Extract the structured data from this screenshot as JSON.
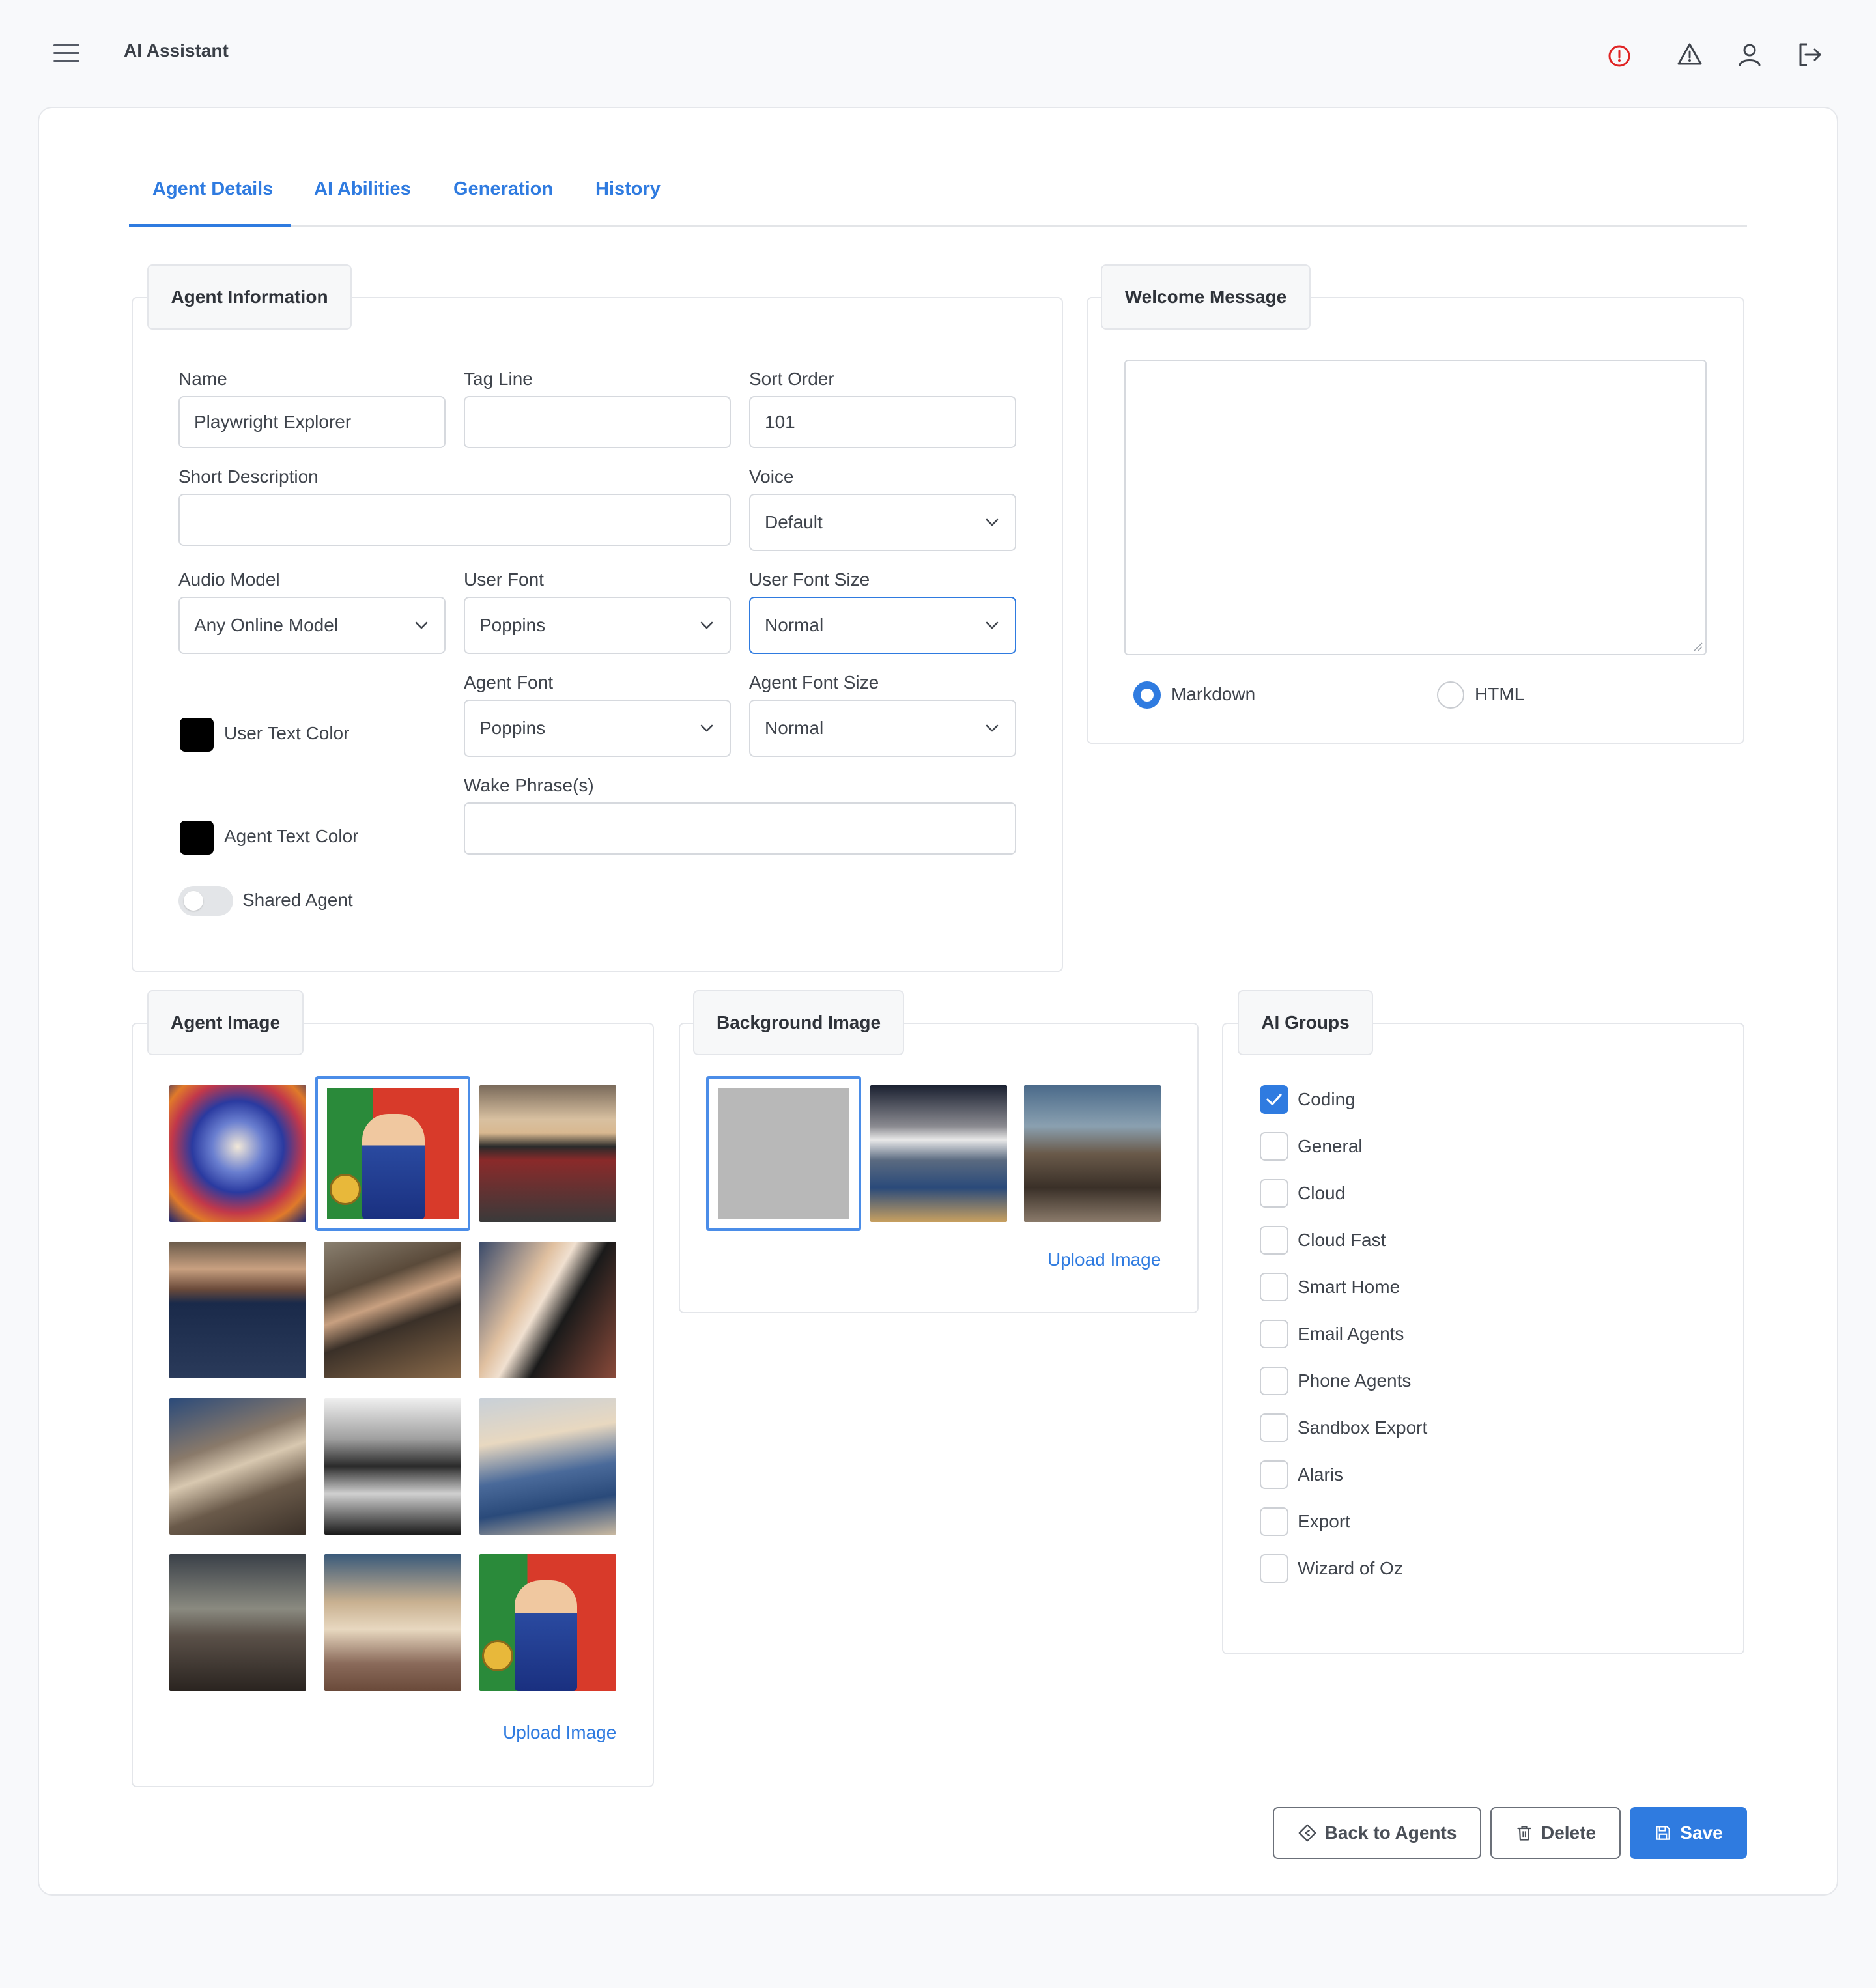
{
  "header": {
    "title": "AI Assistant",
    "icons": [
      "menu-icon",
      "alert-circle-icon",
      "warning-triangle-icon",
      "user-icon",
      "logout-icon"
    ],
    "alert_color": "#e02424"
  },
  "tabs": [
    {
      "label": "Agent Details",
      "active": true
    },
    {
      "label": "AI Abilities",
      "active": false
    },
    {
      "label": "Generation",
      "active": false
    },
    {
      "label": "History",
      "active": false
    }
  ],
  "agent_info": {
    "title": "Agent Information",
    "name_label": "Name",
    "name_value": "Playwright Explorer",
    "tagline_label": "Tag Line",
    "tagline_value": "",
    "sort_label": "Sort Order",
    "sort_value": "101",
    "short_desc_label": "Short Description",
    "short_desc_value": "",
    "voice_label": "Voice",
    "voice_value": "Default",
    "audio_model_label": "Audio Model",
    "audio_model_value": "Any Online Model",
    "user_font_label": "User Font",
    "user_font_value": "Poppins",
    "user_font_size_label": "User Font Size",
    "user_font_size_value": "Normal",
    "agent_font_label": "Agent Font",
    "agent_font_value": "Poppins",
    "agent_font_size_label": "Agent Font Size",
    "agent_font_size_value": "Normal",
    "user_text_color_label": "User Text Color",
    "user_text_color": "#000000",
    "agent_text_color_label": "Agent Text Color",
    "agent_text_color": "#000000",
    "wake_label": "Wake Phrase(s)",
    "wake_value": "",
    "shared_label": "Shared Agent",
    "shared_on": false
  },
  "welcome": {
    "title": "Welcome Message",
    "value": "",
    "format_markdown": "Markdown",
    "format_html": "HTML",
    "selected": "Markdown"
  },
  "agent_image": {
    "title": "Agent Image",
    "upload_label": "Upload Image",
    "selected_index": 1
  },
  "background_image": {
    "title": "Background Image",
    "upload_label": "Upload Image",
    "selected_index": 0
  },
  "ai_groups": {
    "title": "AI Groups",
    "items": [
      {
        "label": "Coding",
        "checked": true
      },
      {
        "label": "General",
        "checked": false
      },
      {
        "label": "Cloud",
        "checked": false
      },
      {
        "label": "Cloud Fast",
        "checked": false
      },
      {
        "label": "Smart Home",
        "checked": false
      },
      {
        "label": "Email Agents",
        "checked": false
      },
      {
        "label": "Phone Agents",
        "checked": false
      },
      {
        "label": "Sandbox Export",
        "checked": false
      },
      {
        "label": "Alaris",
        "checked": false
      },
      {
        "label": "Export",
        "checked": false
      },
      {
        "label": "Wizard of Oz",
        "checked": false
      }
    ]
  },
  "actions": {
    "back_label": "Back to Agents",
    "delete_label": "Delete",
    "save_label": "Save",
    "accent": "#2f7be0"
  }
}
